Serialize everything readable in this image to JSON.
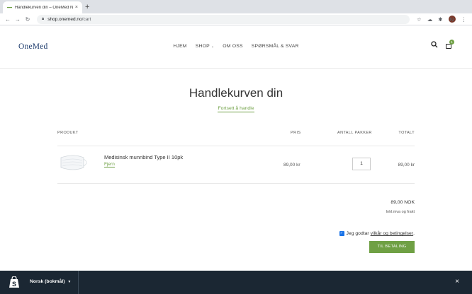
{
  "browser": {
    "tab_title": "Handlekurven din – OneMed N",
    "tab_close": "×",
    "new_tab": "+",
    "url_host": "shop.onemed.no",
    "url_path": "/cart",
    "profile_initial": "N"
  },
  "header": {
    "logo": "OneMed",
    "menu": [
      "HJEM",
      "SHOP",
      "OM OSS",
      "SPØRSMÅL & SVAR"
    ],
    "cart_count": "1"
  },
  "cart": {
    "title": "Handlekurven din",
    "continue_link": "Fortsett å handle",
    "columns": {
      "product": "PRODUKT",
      "price": "PRIS",
      "quantity": "ANTALL PAKKER",
      "total": "TOTALT"
    },
    "items": [
      {
        "name": "Medisinsk munnbind Type II 10pk",
        "remove": "Fjern",
        "price": "89,00 kr",
        "quantity": "1",
        "total": "89,00 kr"
      }
    ],
    "subtotal": "89,00 NOK",
    "tax_note": "Inkl.mva og frakt",
    "terms_prefix": "Jeg godtar",
    "terms_link": "vilkår og betingelser",
    "terms_suffix": ".",
    "checkout": "TIL BETALING"
  },
  "footer_bar": {
    "language": "Norsk (bokmål)",
    "close": "×"
  },
  "colors": {
    "accent": "#6fa044",
    "logo": "#1f3d6e",
    "bottom_bar": "#1b2733"
  }
}
